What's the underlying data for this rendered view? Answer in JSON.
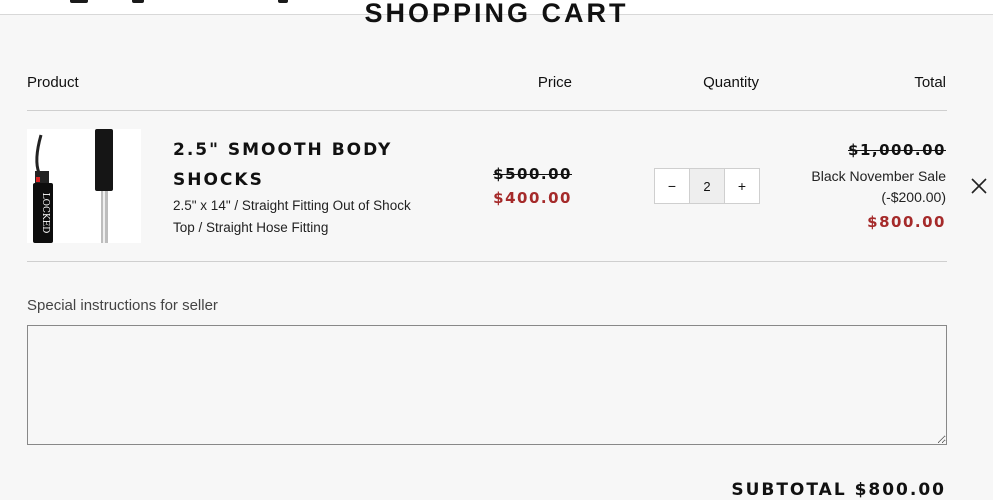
{
  "page": {
    "title": "SHOPPING CART"
  },
  "table": {
    "headers": {
      "product": "Product",
      "price": "Price",
      "quantity": "Quantity",
      "total": "Total"
    }
  },
  "cart": {
    "items": [
      {
        "title": "2.5\" SMOOTH BODY SHOCKS",
        "variant": "2.5\" x 14\" / Straight Fitting Out of Shock Top / Straight Hose Fitting",
        "original_price": "$500.00",
        "sale_price": "$400.00",
        "quantity": "2",
        "qty_decrease": "−",
        "qty_increase": "+",
        "original_total": "$1,000.00",
        "discount_name": "Black November Sale",
        "discount_amount": "(-$200.00)",
        "final_total": "$800.00",
        "image_icon": "shock-absorber-image",
        "remove_icon": "close-icon"
      }
    ]
  },
  "notes": {
    "label": "Special instructions for seller",
    "value": ""
  },
  "summary": {
    "subtotal": "SUBTOTAL $800.00"
  },
  "colors": {
    "sale": "#a52a2a",
    "background": "#f7f7f7",
    "text": "#111111",
    "divider": "#cfcfcf"
  }
}
